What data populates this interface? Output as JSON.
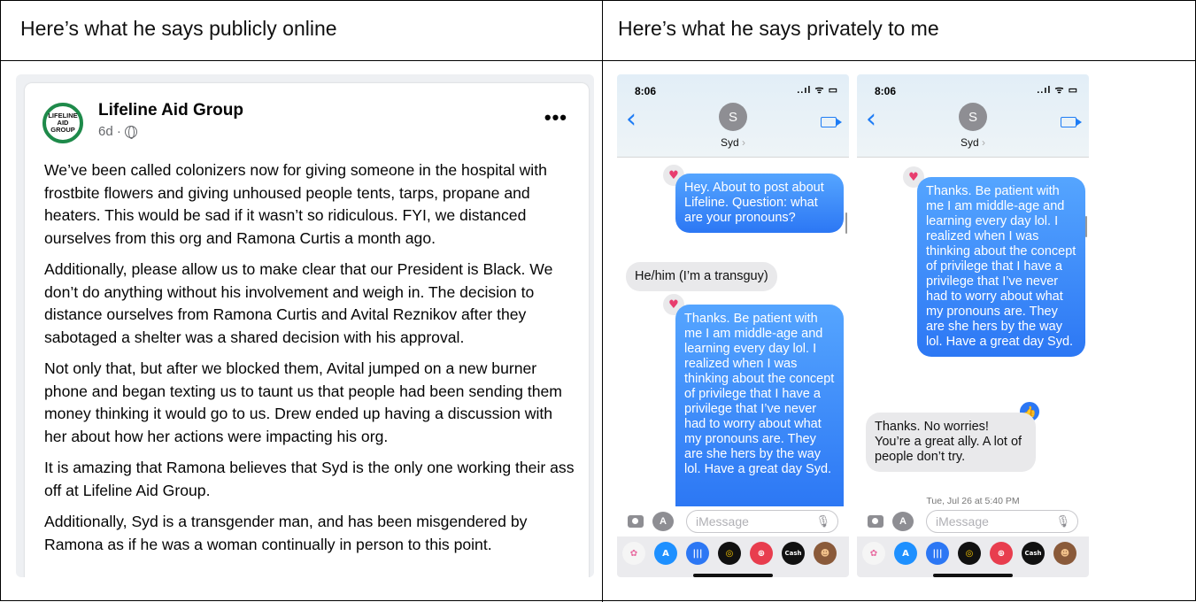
{
  "headers": {
    "left": "Here’s what he says publicly online",
    "right": "Here’s what he says privately to me"
  },
  "post": {
    "org_name": "Lifeline Aid Group",
    "logo_lines": [
      "LIFELINE",
      "AID",
      "GROUP"
    ],
    "meta": "6d ·",
    "more": "•••",
    "paragraphs": [
      "We’ve been called colonizers now for giving someone in the hospital with frostbite flowers and giving unhoused people tents, tarps, propane and heaters. This would be sad if it wasn’t so ridiculous. FYI, we distanced ourselves from this org and Ramona Curtis a month ago.",
      "Additionally, please allow us to make clear that our President is Black. We don’t do anything without his involvement and weigh in. The decision to distance ourselves from Ramona Curtis and Avital Reznikov after they sabotaged a shelter was a shared decision with his approval.",
      "Not only that, but after we blocked them, Avital jumped on a new burner phone and began texting us to taunt us that people had been sending them money thinking it would go to us. Drew ended up having a discussion with her about how her actions were impacting his org.",
      "It is amazing that Ramona believes that Syd is the only one working their ass off at Lifeline Aid Group.",
      "Additionally, Syd is a transgender man, and has been misgendered by Ramona as if he was a woman continually in person to this point."
    ]
  },
  "phone1": {
    "time": "8:06",
    "status": "..ıl ᯤ ▭",
    "avatar": "S",
    "contact": "Syd",
    "msg1": "Hey. About to post about Lifeline. Question: what are your pronouns?",
    "msg2": "He/him (I’m a transguy)",
    "msg3": "Thanks. Be patient with me I am middle-age and learning every day lol. I realized when I was thinking about the concept of privilege that I have a privilege that I’ve never had to worry about what my pronouns are. They are she hers by the way lol. Have a great day Syd.",
    "placeholder": "iMessage"
  },
  "phone2": {
    "time": "8:06",
    "status": "..ıl ᯤ ▭",
    "avatar": "S",
    "contact": "Syd",
    "msg1": "Thanks. Be patient with me I am middle-age and learning every day lol. I realized when I was thinking about the concept of privilege that I have a privilege that I’ve never had to worry about what my pronouns are. They are she hers by the way lol. Have a great day Syd.",
    "msg2": "Thanks. No worries! You’re a great ally. A lot of people don’t try.",
    "timestamp": "Tue, Jul 26 at 5:40 PM",
    "placeholder": "iMessage"
  },
  "tray_apps": [
    {
      "name": "photos-app-icon",
      "color": "#f5f5f5",
      "label": "✿",
      "fg": "#e86aa0"
    },
    {
      "name": "app-store-icon",
      "color": "#1e90ff",
      "label": "A",
      "fg": "#fff"
    },
    {
      "name": "audio-message-icon",
      "color": "#2c77f4",
      "label": "|||",
      "fg": "#fff"
    },
    {
      "name": "activity-icon",
      "color": "#111111",
      "label": "◎",
      "fg": "#ffcc00"
    },
    {
      "name": "search-images-icon",
      "color": "#e83d4e",
      "label": "⊕",
      "fg": "#fff"
    },
    {
      "name": "cash-icon",
      "color": "#111111",
      "label": "Cash",
      "fg": "#fff"
    },
    {
      "name": "memoji-icon",
      "color": "#8a5a3a",
      "label": "☻",
      "fg": "#f3c28b"
    }
  ]
}
